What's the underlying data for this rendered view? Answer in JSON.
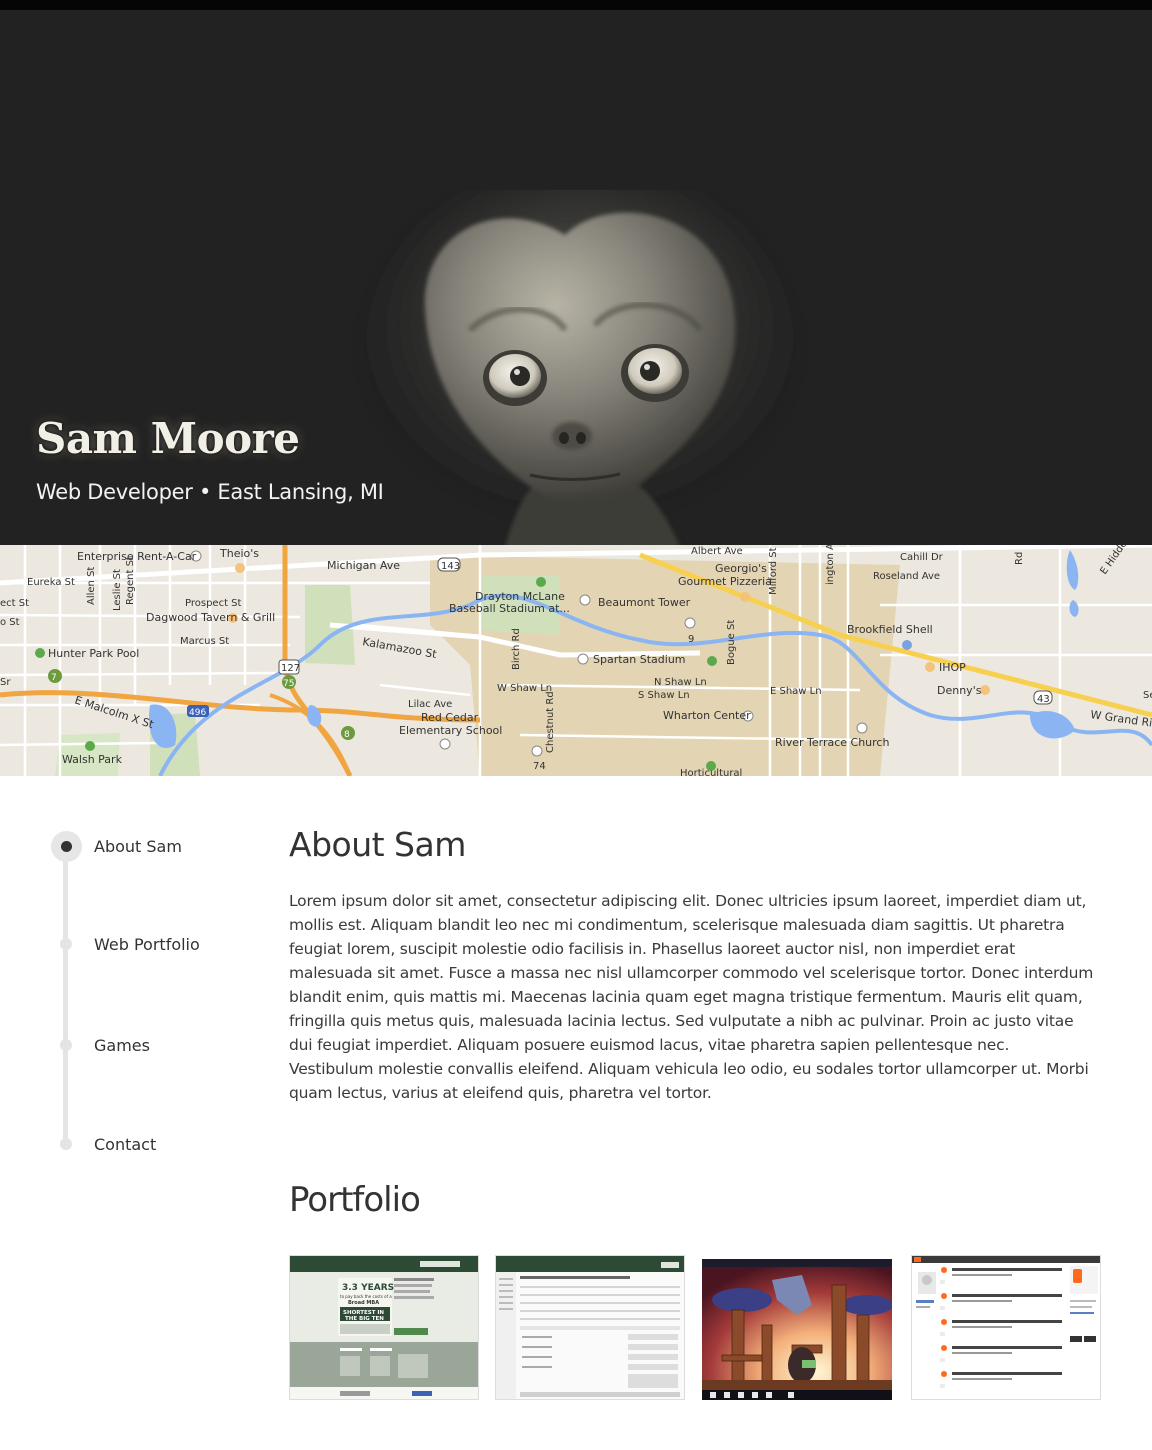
{
  "hero": {
    "name": "Sam Moore",
    "subtitle": "Web Developer • East Lansing, MI",
    "background_color": "#222222"
  },
  "map": {
    "labels": {
      "enterprise": "Enterprise Rent-A-Car",
      "theios": "Theio's",
      "michigan_ave": "Michigan Ave",
      "hwy143": "143",
      "albert_ave": "Albert Ave",
      "georgios": "Georgio's",
      "gourmet_pizzeria": "Gourmet Pizzeria",
      "cahill_dr": "Cahill Dr",
      "roseland_ave": "Roseland Ave",
      "e_hidden": "E Hidden",
      "eureka_st": "Eureka St",
      "allen_st": "Allen St",
      "regent_st": "Regent St",
      "leslie_st": "Leslie St",
      "ect_st": "ect St",
      "prospect_st": "Prospect St",
      "dagwood": "Dagwood Tavern & Grill",
      "marcus_st": "Marcus St",
      "o_st": "o St",
      "drayton1": "Drayton McLane",
      "drayton2": "Baseball Stadium at...",
      "beaumont": "Beaumont Tower",
      "milford_st": "Milford St",
      "ington_ave": "ington Ave",
      "rd_right": "Rd",
      "brookfield": "Brookfield Shell",
      "hunter_park": "Hunter Park Pool",
      "kalamazoo": "Kalamazoo St",
      "birch_rd": "Birch Rd",
      "spartan": "Spartan Stadium",
      "bogue_st": "Bogue St",
      "nine": "9",
      "ihop": "IHOP",
      "hwy127": "127",
      "hwy75": "75",
      "seven": "7",
      "sr": "Sr",
      "w_shaw": "W Shaw Ln",
      "n_shaw": "N Shaw Ln",
      "s_shaw": "S Shaw Ln",
      "e_shaw": "E Shaw Ln",
      "dennys": "Denny's",
      "hwy43": "43",
      "w_grand": "W Grand River",
      "se": "Se",
      "e_malcolm": "E Malcolm X St",
      "hwy496": "496",
      "lilac": "Lilac Ave",
      "red_cedar1": "Red Cedar",
      "red_cedar2": "Elementary School",
      "chestnut": "Chestnut Rd",
      "wharton": "Wharton Center",
      "river_terrace": "River Terrace Church",
      "eight": "8",
      "walsh": "Walsh Park",
      "seventy_four": "74",
      "horticultural": "Horticultural"
    }
  },
  "nav": {
    "items": [
      {
        "label": "About Sam",
        "active": true
      },
      {
        "label": "Web Portfolio",
        "active": false
      },
      {
        "label": "Games",
        "active": false
      },
      {
        "label": "Contact",
        "active": false
      }
    ]
  },
  "about": {
    "title": "About Sam",
    "body": "Lorem ipsum dolor sit amet, consectetur adipiscing elit. Donec ultricies ipsum laoreet, imperdiet diam ut, mollis est. Aliquam blandit leo nec mi condimentum, scelerisque malesuada diam sagittis. Ut pharetra feugiat lorem, suscipit molestie odio facilisis in. Phasellus laoreet auctor nisl, non imperdiet erat malesuada sit amet. Fusce a massa nec nisl ullamcorper commodo vel scelerisque tortor. Donec interdum blandit enim, quis mattis mi. Maecenas lacinia quam eget magna tristique fermentum. Mauris elit quam, fringilla quis metus quis, malesuada lacinia lectus. Sed vulputate a nibh ac pulvinar. Proin ac justo vitae dui feugiat imperdiet. Aliquam posuere euismod lacus, vitae pharetra sapien pellentesque nec. Vestibulum molestie convallis eleifend. Aliquam vehicula leo odio, eu sodales tortor ullamcorper ut. Morbi quam lectus, varius at eleifend quis, pharetra vel tortor."
  },
  "portfolio": {
    "title": "Portfolio",
    "thumb1": {
      "big": "3.3 YEARS",
      "line2": "to pay back the costs of a",
      "line3": "Broad MBA",
      "line4": "SHORTEST IN",
      "line5": "THE BIG TEN"
    }
  }
}
